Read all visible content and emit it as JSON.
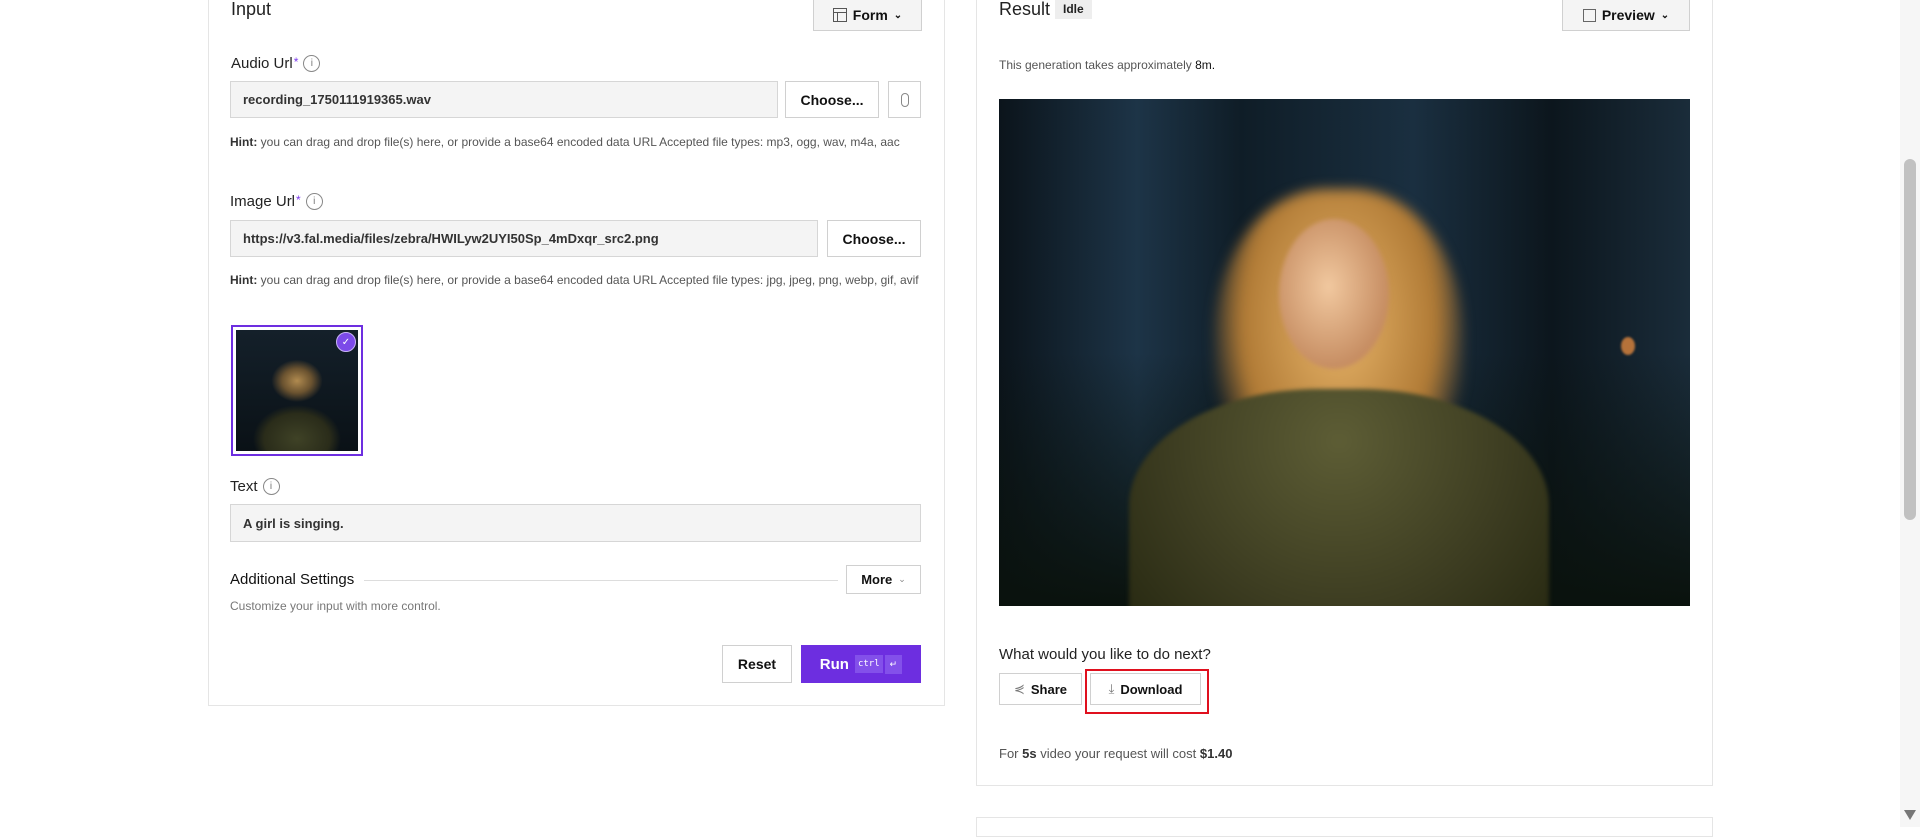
{
  "input_panel": {
    "title": "Input",
    "mode_button": "Form",
    "audio_url": {
      "label": "Audio Url",
      "required_mark": "*",
      "value": "recording_1750111919365.wav",
      "choose_label": "Choose...",
      "hint_bold": "Hint:",
      "hint": " you can drag and drop file(s) here, or provide a base64 encoded data URL Accepted file types: mp3, ogg, wav, m4a, aac"
    },
    "image_url": {
      "label": "Image Url",
      "required_mark": "*",
      "value": "https://v3.fal.media/files/zebra/HWILyw2UYI50Sp_4mDxqr_src2.png",
      "choose_label": "Choose...",
      "hint_bold": "Hint:",
      "hint": " you can drag and drop file(s) here, or provide a base64 encoded data URL Accepted file types: jpg, jpeg, png, webp, gif, avif"
    },
    "text": {
      "label": "Text",
      "value": "A girl is singing."
    },
    "additional_settings": {
      "title": "Additional Settings",
      "more_label": "More",
      "description": "Customize your input with more control."
    },
    "reset_label": "Reset",
    "run_label": "Run",
    "run_shortcut_key": "ctrl",
    "run_shortcut_enter": "↵"
  },
  "result_panel": {
    "title": "Result",
    "status": "Idle",
    "view_button": "Preview",
    "eta_prefix": "This generation takes approximately ",
    "eta_value": "8m.",
    "next_prompt": "What would you like to do next?",
    "share_label": "Share",
    "download_label": "Download",
    "cost_prefix": "For ",
    "cost_duration": "5s",
    "cost_middle": " video your request will cost ",
    "cost_value": "$1.40"
  },
  "colors": {
    "accent": "#6d2ee0",
    "highlight": "#e0101e"
  }
}
